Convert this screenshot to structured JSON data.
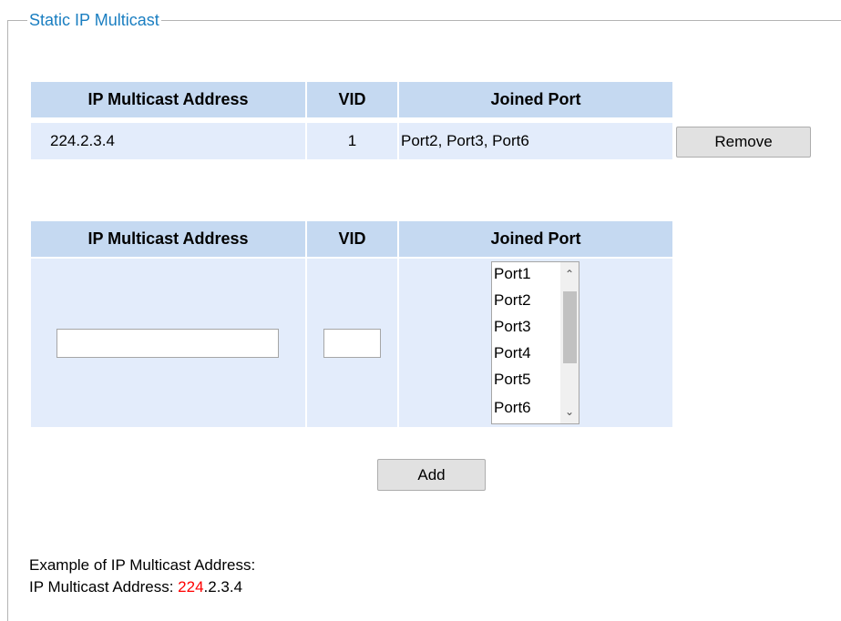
{
  "fieldset": {
    "legend": "Static IP Multicast"
  },
  "existing_table": {
    "headers": [
      "IP Multicast Address",
      "VID",
      "Joined Port"
    ],
    "rows": [
      {
        "ip": "224.2.3.4",
        "vid": "1",
        "ports": "Port2, Port3, Port6",
        "action": "Remove"
      }
    ]
  },
  "add_table": {
    "headers": [
      "IP Multicast Address",
      "VID",
      "Joined Port"
    ],
    "ip_value": "",
    "vid_value": "",
    "port_options": [
      "Port1",
      "Port2",
      "Port3",
      "Port4",
      "Port5",
      "Port6"
    ],
    "add_label": "Add"
  },
  "example": {
    "line1": "Example of IP Multicast Address:",
    "line2_prefix": "IP Multicast Address: ",
    "line2_highlight": "224",
    "line2_suffix": ".2.3.4",
    "highlight_color": "#ff0000"
  }
}
